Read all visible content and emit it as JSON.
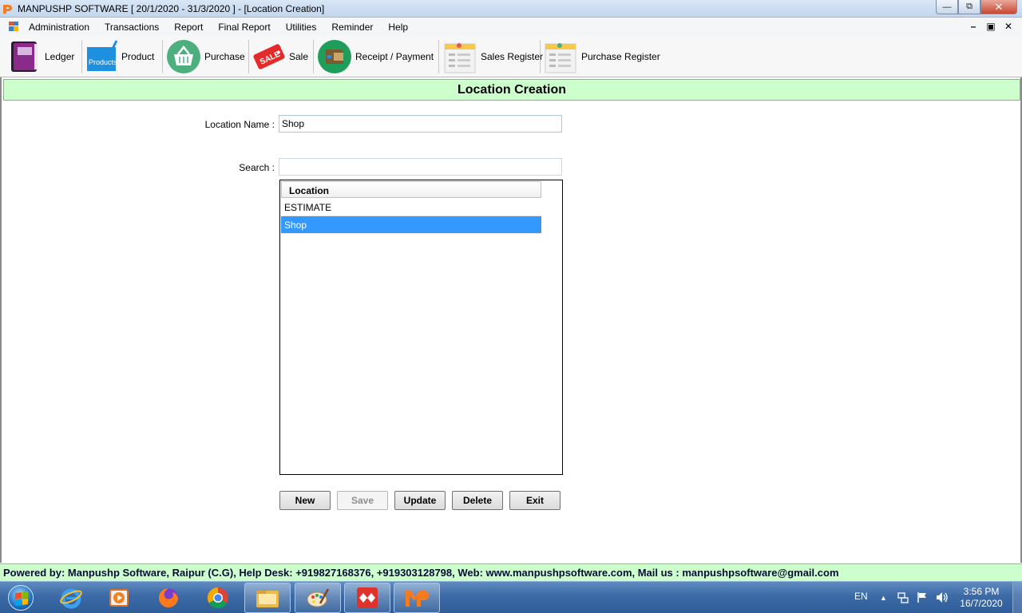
{
  "window": {
    "title": "MANPUSHP SOFTWARE [ 20/1/2020 - 31/3/2020 ]   - [Location Creation]",
    "minimize_glyph": "—",
    "restore_glyph": "⧉",
    "close_glyph": "✕"
  },
  "menu": {
    "items": [
      "Administration",
      "Transactions",
      "Report",
      "Final Report",
      "Utilities",
      "Reminder",
      "Help"
    ],
    "mdi_minimize": "–",
    "mdi_restore": "▣",
    "mdi_close": "✕"
  },
  "toolbar": {
    "ledger": "Ledger",
    "product": "Product",
    "product_icon_text": "Products",
    "purchase": "Purchase",
    "sale": "Sale",
    "sale_icon_text": "SALE",
    "receipt_payment": "Receipt / Payment",
    "sales_register": "Sales Register",
    "purchase_register": "Purchase Register"
  },
  "form": {
    "header": "Location Creation",
    "location_name_label": "Location Name :",
    "location_name_value": "Shop",
    "search_label": "Search :",
    "search_value": "",
    "list": {
      "column": "Location",
      "rows": [
        "ESTIMATE",
        "Shop"
      ],
      "selected_index": 1
    },
    "buttons": {
      "new": "New",
      "save": "Save",
      "update": "Update",
      "delete": "Delete",
      "exit": "Exit"
    }
  },
  "footer": {
    "text": "Powered by: Manpushp Software, Raipur (C.G), Help Desk: +919827168376, +919303128798, Web: www.manpushpsoftware.com,  Mail us :  manpushpsoftware@gmail.com"
  },
  "taskbar": {
    "language": "EN",
    "time": "3:56 PM",
    "date": "16/7/2020"
  },
  "colors": {
    "header_bg": "#ccffcc",
    "selection": "#3399ff",
    "taskbar": "#3c6aa6"
  }
}
